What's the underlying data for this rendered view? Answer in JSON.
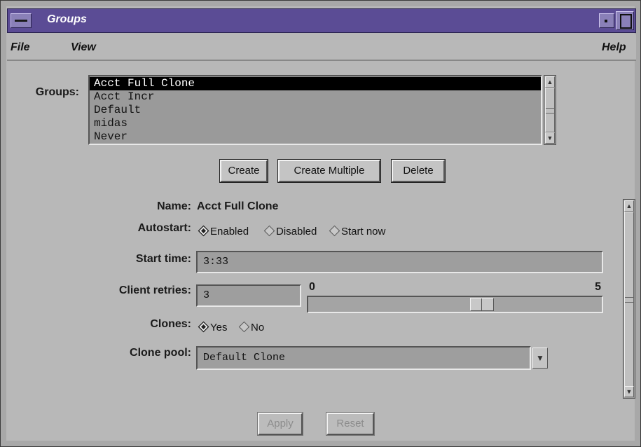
{
  "window": {
    "title": "Groups"
  },
  "menubar": {
    "file": "File",
    "view": "View",
    "help": "Help"
  },
  "groups_label": "Groups:",
  "groups_list": [
    "Acct Full Clone",
    "Acct Incr",
    "Default",
    "midas",
    "Never"
  ],
  "selected_group": "Acct Full Clone",
  "buttons": {
    "create": "Create",
    "create_multiple": "Create Multiple",
    "delete": "Delete",
    "apply": "Apply",
    "reset": "Reset"
  },
  "form": {
    "name_label": "Name:",
    "name_value": "Acct Full Clone",
    "autostart_label": "Autostart:",
    "autostart_options": [
      "Enabled",
      "Disabled",
      "Start now"
    ],
    "autostart_selected": "Enabled",
    "start_time_label": "Start time:",
    "start_time_value": "3:33",
    "client_retries_label": "Client retries:",
    "client_retries_value": "3",
    "slider_min": "0",
    "slider_max": "5",
    "slider_value": 3,
    "clones_label": "Clones:",
    "clones_options": [
      "Yes",
      "No"
    ],
    "clones_selected": "Yes",
    "clone_pool_label": "Clone pool:",
    "clone_pool_value": "Default Clone"
  },
  "colors": {
    "titlebar": "#5b4c95",
    "window_bg": "#b8b8b8",
    "field_bg": "#9e9e9e",
    "selection": "#000000"
  }
}
